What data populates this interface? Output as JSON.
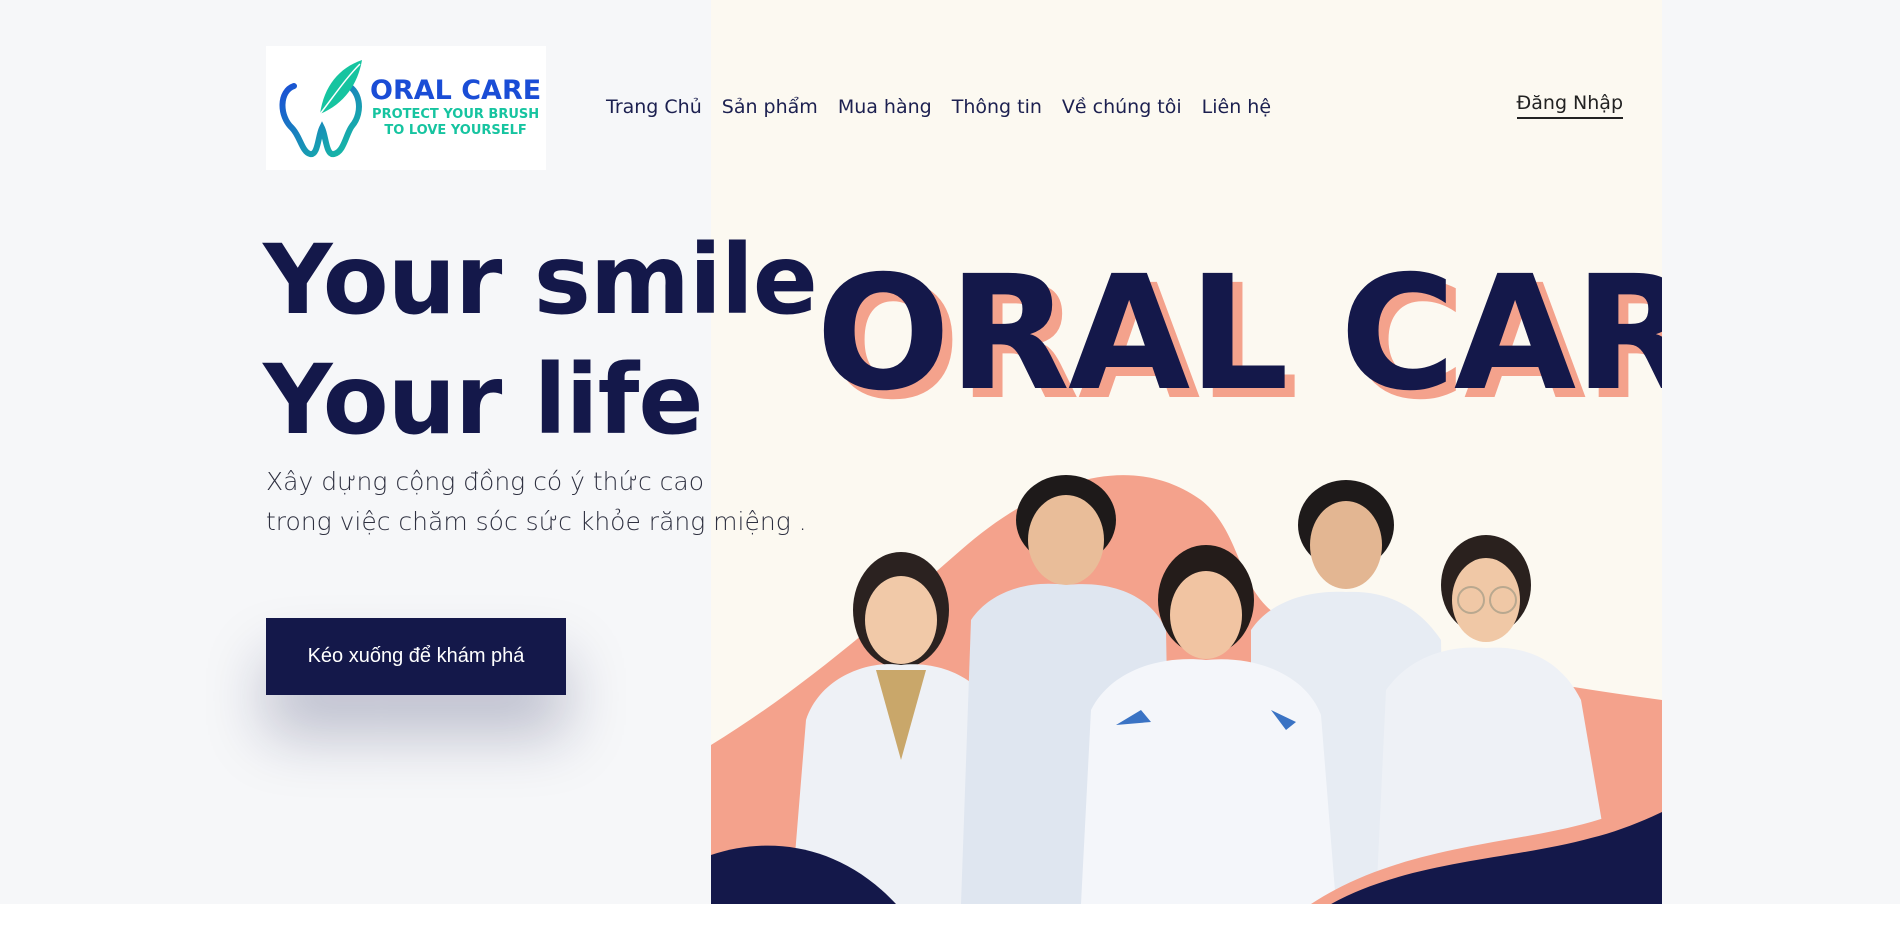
{
  "logo": {
    "title": "ORAL CARE",
    "tagline_line1": "PROTECT YOUR BRUSH",
    "tagline_line2": "TO LOVE YOURSELF",
    "icon": "tooth-leaf-icon"
  },
  "nav": {
    "items": [
      "Trang Chủ",
      "Sản phẩm",
      "Mua hàng",
      "Thông tin",
      "Về chúng tôi",
      "Liên hệ"
    ]
  },
  "auth": {
    "login_label": "Đăng Nhập"
  },
  "hero": {
    "headline_line1": "Your smile",
    "headline_line2": "Your life",
    "subtext_line1": "Xây dựng cộng đồng có ý thức cao",
    "subtext_line2": "trong việc chăm sóc sức khỏe răng miệng .",
    "cta_label": "Kéo xuống để khám phá",
    "banner_text": "ORAL CARE"
  },
  "colors": {
    "navy": "#14184a",
    "salmon": "#f4a28c",
    "cream": "#fcf9f1",
    "logo_blue": "#1a4dd6",
    "logo_teal": "#16c4a0"
  }
}
